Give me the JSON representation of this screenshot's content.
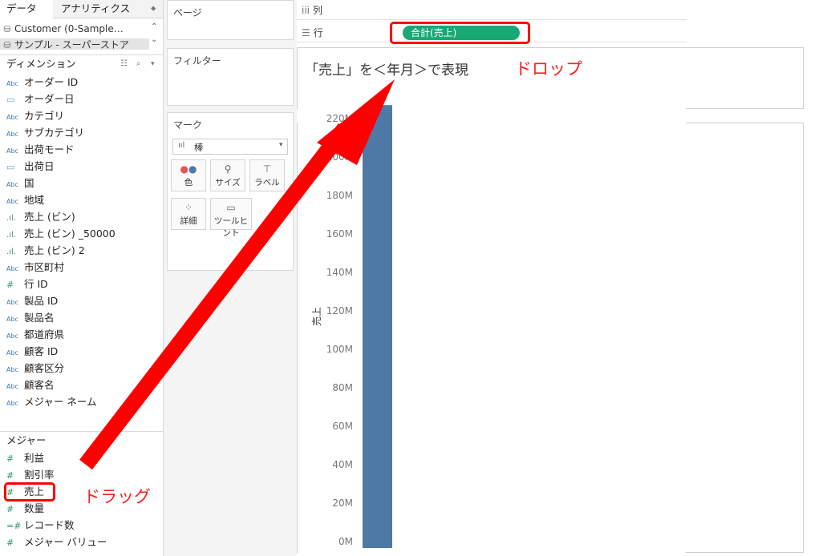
{
  "tabs": {
    "data": "データ",
    "analytics": "アナリティクス"
  },
  "datasources": [
    {
      "label": "Customer (0-Sample…",
      "icon": "database-icon"
    },
    {
      "label": "サンプル - スーパーストア",
      "icon": "datasource-icon"
    }
  ],
  "dimensions": {
    "header": "ディメンション",
    "items": [
      {
        "type": "Abc",
        "label": "オーダー ID"
      },
      {
        "type": "date",
        "label": "オーダー日"
      },
      {
        "type": "Abc",
        "label": "カテゴリ"
      },
      {
        "type": "Abc",
        "label": "サブカテゴリ"
      },
      {
        "type": "Abc",
        "label": "出荷モード"
      },
      {
        "type": "date",
        "label": "出荷日"
      },
      {
        "type": "Abc",
        "label": "国"
      },
      {
        "type": "Abc",
        "label": "地域"
      },
      {
        "type": "bin",
        "label": "売上 (ビン)"
      },
      {
        "type": "bin",
        "label": "売上 (ビン) _50000"
      },
      {
        "type": "bin",
        "label": "売上 (ビン) 2"
      },
      {
        "type": "Abc",
        "label": "市区町村"
      },
      {
        "type": "#",
        "label": "行 ID"
      },
      {
        "type": "Abc",
        "label": "製品 ID"
      },
      {
        "type": "Abc",
        "label": "製品名"
      },
      {
        "type": "Abc",
        "label": "都道府県"
      },
      {
        "type": "Abc",
        "label": "顧客 ID"
      },
      {
        "type": "Abc",
        "label": "顧客区分"
      },
      {
        "type": "Abc",
        "label": "顧客名"
      },
      {
        "type": "Abc",
        "label": "メジャー ネーム"
      }
    ]
  },
  "measures": {
    "header": "メジャー",
    "items": [
      {
        "type": "#",
        "label": "利益"
      },
      {
        "type": "#",
        "label": "割引率"
      },
      {
        "type": "#",
        "label": "売上"
      },
      {
        "type": "#",
        "label": "数量"
      },
      {
        "type": "=#",
        "label": "レコード数"
      },
      {
        "type": "#",
        "label": "メジャー バリュー"
      }
    ]
  },
  "cards": {
    "pages": "ページ",
    "filters": "フィルター",
    "marks": "マーク",
    "mark_type": "棒",
    "mark_buttons": [
      "色",
      "サイズ",
      "ラベル",
      "詳細",
      "ツールヒント"
    ]
  },
  "shelves": {
    "columns": "列",
    "rows": "行",
    "row_pill": "合計(売上)"
  },
  "viz": {
    "title": "「売上」を＜年月＞で表現",
    "ylabel": "売上"
  },
  "annotations": {
    "drop": "ドロップ",
    "drag": "ドラッグ",
    "color": "#ff0000"
  },
  "chart_data": {
    "type": "bar",
    "categories": [
      ""
    ],
    "values": [
      227000000
    ],
    "title": "「売上」を＜年月＞で表現",
    "xlabel": "",
    "ylabel": "売上",
    "ylim": [
      0,
      230000000
    ],
    "yticks": [
      "0M",
      "20M",
      "40M",
      "60M",
      "80M",
      "100M",
      "120M",
      "140M",
      "160M",
      "180M",
      "200M",
      "220M"
    ],
    "bar_color": "#4e79a7",
    "grid": false
  }
}
